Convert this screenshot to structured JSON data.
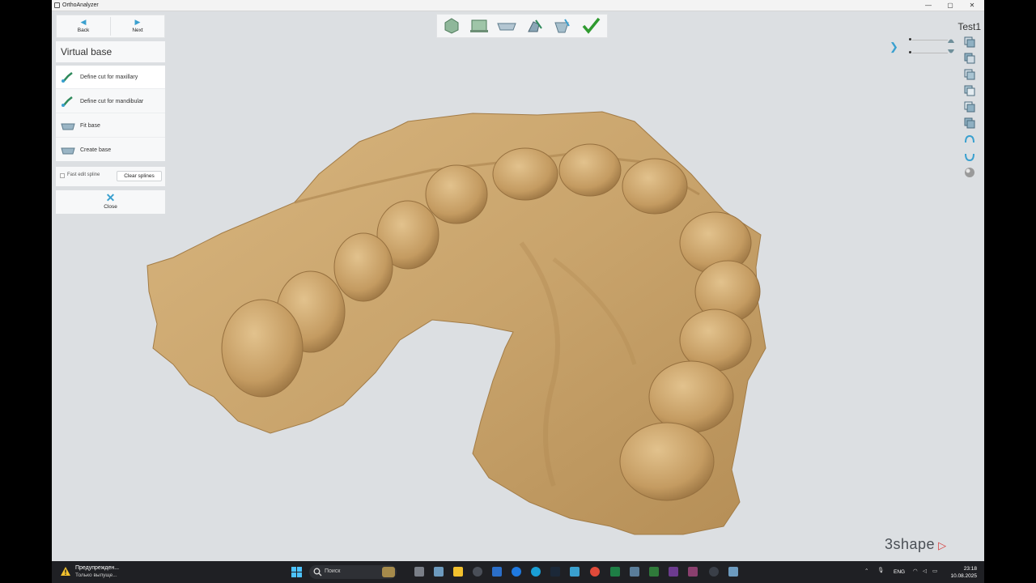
{
  "window": {
    "title": "OrthoAnalyzer",
    "controls": [
      "—",
      "▢",
      "✕"
    ]
  },
  "nav": {
    "back_label": "Back",
    "next_label": "Next"
  },
  "section_title": "Virtual base",
  "steps": [
    {
      "label": "Define cut for maxillary",
      "icon": "cut-tool-icon",
      "active": true
    },
    {
      "label": "Define cut for mandibular",
      "icon": "cut-tool-icon",
      "active": false
    },
    {
      "label": "Fit base",
      "icon": "base-icon",
      "active": false
    },
    {
      "label": "Create base",
      "icon": "base-icon",
      "active": false
    }
  ],
  "spline": {
    "checkbox_label": "Fast edit spline",
    "checked": false,
    "clear_label": "Clear splines"
  },
  "close_label": "Close",
  "workflow_icons": [
    "model-set-icon",
    "scan-icon",
    "base-icon",
    "sculpt-icon",
    "trim-icon",
    "check-icon"
  ],
  "project_name": "Test1",
  "logo_text": "3shape",
  "taskbar": {
    "warning_title": "Предупрежден...",
    "warning_sub": "Только выпуще...",
    "search_placeholder": "Поиск",
    "lang": "ENG",
    "time": "23:18",
    "date": "10.08.2025"
  },
  "colors": {
    "accent": "#3aa0cf",
    "model": "#c9a46c",
    "viewport_bg": "#dcdfe2"
  }
}
